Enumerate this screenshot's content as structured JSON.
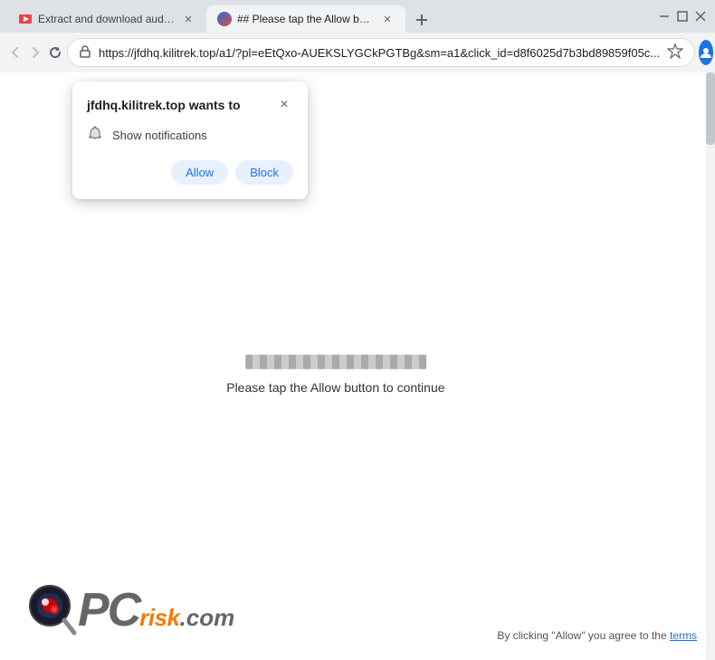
{
  "browser": {
    "tabs": [
      {
        "id": "tab1",
        "title": "Extract and download audio an...",
        "active": false,
        "favicon": "video"
      },
      {
        "id": "tab2",
        "title": "## Please tap the Allow button ...",
        "active": true,
        "favicon": "page"
      }
    ],
    "new_tab_label": "+",
    "window_controls": {
      "minimize": "—",
      "maximize": "□",
      "close": "✕"
    }
  },
  "address_bar": {
    "url": "https://jfdhq.kilitrek.top/a1/?pl=eEtQxo-AUEKSLYGCkPGTBg&sm=a1&click_id=d8f6025d7b3bd89859f05c...",
    "lock_icon": "lock",
    "star_icon": "star",
    "profile_icon": "person",
    "menu_icon": "⋮"
  },
  "nav": {
    "back_icon": "←",
    "forward_icon": "→",
    "refresh_icon": "↻"
  },
  "popup": {
    "title": "jfdhq.kilitrek.top wants to",
    "close_icon": "×",
    "permission_icon": "bell",
    "permission_text": "Show notifications",
    "allow_label": "Allow",
    "block_label": "Block"
  },
  "page": {
    "instruction_text": "Please tap the Allow button to continue"
  },
  "footer": {
    "logo_pc": "PC",
    "logo_risk": "risk",
    "logo_dot_com": ".com",
    "terms_text": "By clicking \"Allow\" you agree to the",
    "terms_link": "terms"
  }
}
